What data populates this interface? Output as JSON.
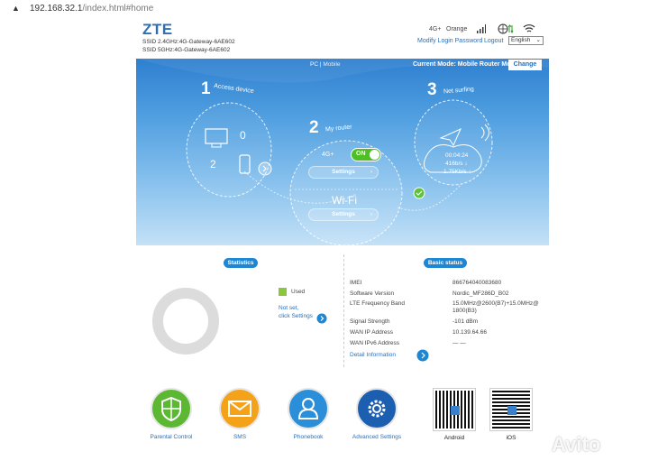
{
  "browser": {
    "warning_icon": "warning-icon",
    "url_host": "192.168.32.1",
    "url_path": "/index.html#home"
  },
  "header": {
    "logo": "ZTE",
    "ssid_24": "SSID 2.4GHz:4G-Gateway-6AE602",
    "ssid_5": "SSID 5GHz:4G-Gateway-6AE602",
    "network_type": "4G+",
    "operator": "Orange",
    "modify_password": "Modify Login Password",
    "logout": "Logout",
    "language": "English"
  },
  "mode": {
    "pc": "PC",
    "separator": "|",
    "mobile": "Mobile",
    "current_mode": "Current Mode: Mobile Router Mode",
    "change_button": "Change"
  },
  "hero": {
    "step1_num": "1",
    "step1_title": "Access device",
    "computers": "0",
    "phones": "2",
    "step2_num": "2",
    "step2_title": "My router",
    "net_label": "4G+",
    "switch_label": "ON",
    "settings1": "Settings",
    "wifi_label": "Wi-Fi",
    "settings2": "Settings",
    "step3_num": "3",
    "step3_title": "Net surfing",
    "duration": "00:04:24",
    "download": "416b/s",
    "upload": "1.75Kb/s"
  },
  "statistics": {
    "badge": "Statistics",
    "used_label": "Used",
    "not_set": "Not set,",
    "click_settings": "click Settings"
  },
  "basic_status": {
    "badge": "Basic status",
    "rows": [
      {
        "label": "IMEI",
        "value": "866764040083680"
      },
      {
        "label": "Software Version",
        "value": "Nordic_MF286D_B02"
      },
      {
        "label": "LTE Frequency Band",
        "value": "15.0MHz@2600(B7)+15.0MHz@",
        "value2": "1800(B3)"
      },
      {
        "label": "Signal Strength",
        "value": "-101 dBm"
      },
      {
        "label": "WAN IP Address",
        "value": "10.139.64.66"
      },
      {
        "label": "WAN IPv6 Address",
        "value": "— —"
      }
    ],
    "detail_link": "Detail Information"
  },
  "shortcuts": [
    {
      "label": "Parental Control",
      "icon": "shield-icon",
      "color": "#5cb832"
    },
    {
      "label": "SMS",
      "icon": "envelope-icon",
      "color": "#f3a21a"
    },
    {
      "label": "Phonebook",
      "icon": "person-icon",
      "color": "#2a8fd8"
    },
    {
      "label": "Advanced Settings",
      "icon": "gear-icon",
      "color": "#1c5fb0"
    }
  ],
  "apps": {
    "android": "Android",
    "ios": "iOS"
  },
  "watermark": "Avito",
  "colors": {
    "accent": "#2a6fb8",
    "hero_top": "#2e7fd0",
    "ring": "#dcdcdc",
    "used": "#8cc63f"
  }
}
